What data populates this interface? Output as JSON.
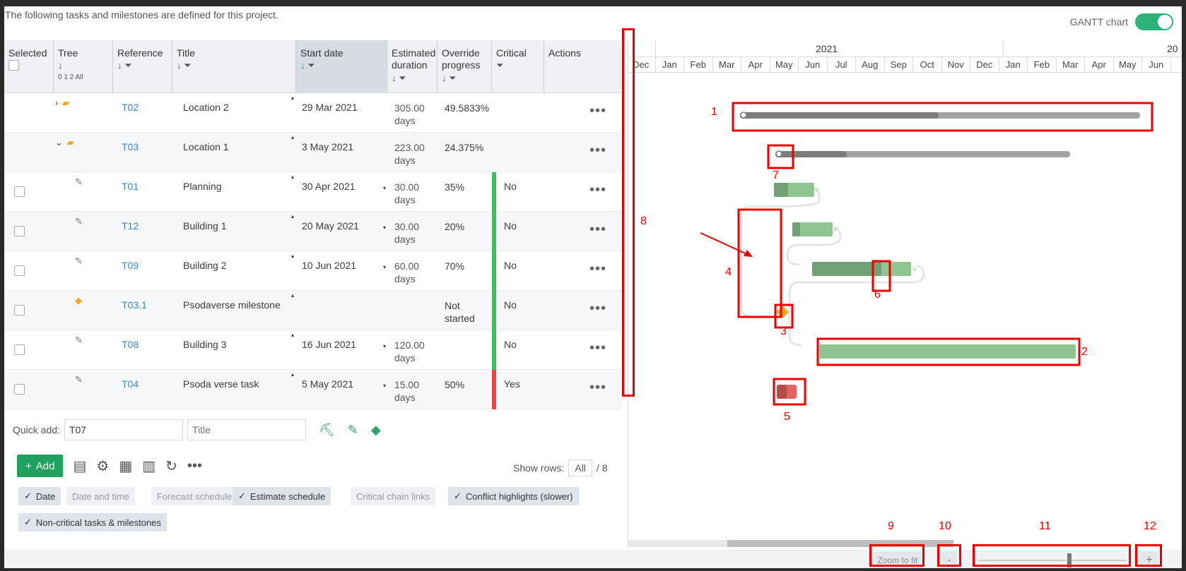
{
  "intro_text": "The following tasks and milestones are defined for this project.",
  "gantt_toggle_label": "GANTT chart",
  "columns": {
    "selected": "Selected",
    "tree": "Tree",
    "tree_levels": "0 1 2 All",
    "reference": "Reference",
    "title": "Title",
    "start_date": "Start date",
    "estimated_duration": "Estimated duration",
    "override_progress": "Override progress",
    "critical": "Critical",
    "actions": "Actions"
  },
  "rows": [
    {
      "ref": "T02",
      "title": "Location 2",
      "start": "29 Mar 2021",
      "duration": "305.00",
      "unit": "days",
      "progress": "49.5833%",
      "critical": "",
      "type": "location",
      "checkbox": false
    },
    {
      "ref": "T03",
      "title": "Location 1",
      "start": "3 May 2021",
      "duration": "223.00",
      "unit": "days",
      "progress": "24.375%",
      "critical": "",
      "type": "location",
      "checkbox": false
    },
    {
      "ref": "T01",
      "title": "Planning",
      "start": "30 Apr 2021",
      "duration": "30.00",
      "unit": "days",
      "progress": "35%",
      "critical": "No",
      "type": "task",
      "checkbox": true
    },
    {
      "ref": "T12",
      "title": "Building 1",
      "start": "20 May 2021",
      "duration": "30.00",
      "unit": "days",
      "progress": "20%",
      "critical": "No",
      "type": "task",
      "checkbox": true
    },
    {
      "ref": "T09",
      "title": "Building 2",
      "start": "10 Jun 2021",
      "duration": "60.00",
      "unit": "days",
      "progress": "70%",
      "critical": "No",
      "type": "task",
      "checkbox": true
    },
    {
      "ref": "T03.1",
      "title": "Psodaverse milestone",
      "start": "",
      "duration": "",
      "unit": "",
      "progress": "Not started",
      "critical": "No",
      "type": "milestone",
      "checkbox": true
    },
    {
      "ref": "T08",
      "title": "Building 3",
      "start": "16 Jun 2021",
      "duration": "120.00",
      "unit": "days",
      "progress": "",
      "critical": "No",
      "type": "task",
      "checkbox": true
    },
    {
      "ref": "T04",
      "title": "Psoda verse task",
      "start": "5 May 2021",
      "duration": "15.00",
      "unit": "days",
      "progress": "50%",
      "critical": "Yes",
      "type": "task",
      "checkbox": true
    }
  ],
  "quick_add": {
    "label": "Quick add:",
    "ref_value": "T07",
    "title_placeholder": "Title"
  },
  "toolbar": {
    "add_label": "Add"
  },
  "show_rows": {
    "label": "Show rows:",
    "value": "All",
    "total": "/ 8"
  },
  "chips": {
    "date": "Date",
    "date_time": "Date and time",
    "forecast": "Forecast schedule",
    "estimate": "Estimate schedule",
    "critical_chain": "Critical chain links",
    "conflict": "Conflict highlights (slower)",
    "noncritical": "Non-critical tasks & milestones"
  },
  "timeline": {
    "year1": "2021",
    "year2": "20",
    "months": [
      "Dec",
      "Jan",
      "Feb",
      "Mar",
      "Apr",
      "May",
      "Jun",
      "Jul",
      "Aug",
      "Sep",
      "Oct",
      "Nov",
      "Dec",
      "Jan",
      "Feb",
      "Mar",
      "Apr",
      "May",
      "Jun"
    ]
  },
  "zoom": {
    "fit": "Zoom to fit",
    "minus": "-",
    "plus": "+",
    "level": 0.62
  },
  "annotations": [
    "1",
    "2",
    "3",
    "4",
    "5",
    "6",
    "7",
    "8",
    "9",
    "10",
    "11",
    "12"
  ],
  "colors": {
    "green": "#1fa05d",
    "crit_green": "#3cc05a",
    "crit_red": "#ef4444",
    "bar_green": "#8fc591",
    "bar_green_dark": "#6fa174",
    "bar_gray": "#a3a3a3",
    "bar_gray_dark": "#7c7c7c",
    "annot_red": "#e00000",
    "milestone_orange": "#f5a623"
  }
}
